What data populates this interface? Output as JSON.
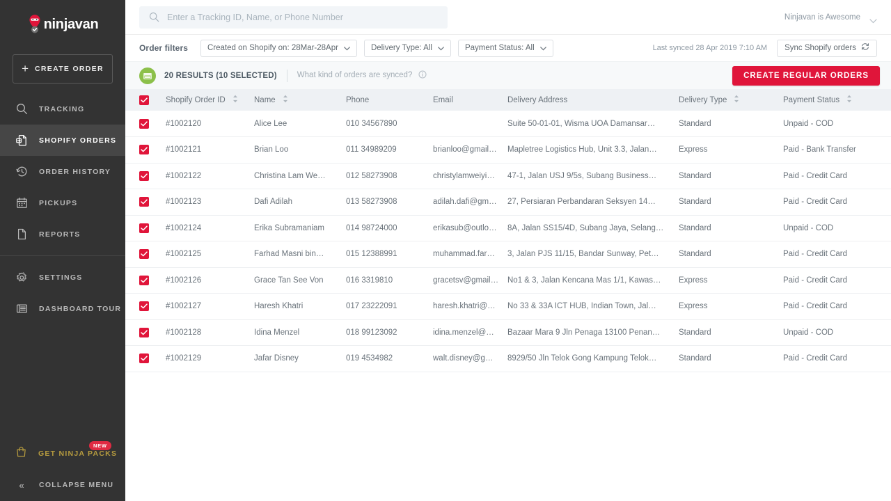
{
  "brand": {
    "name": "ninjavan",
    "accent_red": "#e0153a",
    "sidebar_bg": "#333333",
    "green": "#8cc04a",
    "gold": "#b79c3f"
  },
  "sidebar": {
    "create_order_label": "CREATE ORDER",
    "items": [
      {
        "label": "TRACKING",
        "icon": "search-icon",
        "active": false
      },
      {
        "label": "SHOPIFY ORDERS",
        "icon": "shopify-orders-icon",
        "active": true
      },
      {
        "label": "ORDER HISTORY",
        "icon": "history-clock-icon",
        "active": false
      },
      {
        "label": "PICKUPS",
        "icon": "calendar-icon",
        "active": false
      },
      {
        "label": "REPORTS",
        "icon": "document-icon",
        "active": false
      },
      {
        "label": "SETTINGS",
        "icon": "gear-icon",
        "active": false
      },
      {
        "label": "DASHBOARD TOUR",
        "icon": "list-panel-icon",
        "active": false
      }
    ],
    "ninja_packs": {
      "label": "GET NINJA PACKS",
      "badge": "NEW",
      "icon": "shopping-bag-icon"
    },
    "collapse": {
      "label": "COLLAPSE MENU",
      "icon": "double-chevron-left-icon"
    }
  },
  "topbar": {
    "search_placeholder": "Enter a Tracking ID, Name, or Phone Number",
    "search_value": "",
    "user_name": "Ninjavan is Awesome"
  },
  "filters": {
    "label": "Order filters",
    "chips": [
      {
        "text": "Created on Shopify on: 28Mar-28Apr"
      },
      {
        "text": "Delivery Type: All"
      },
      {
        "text": "Payment Status: All"
      }
    ],
    "last_synced": "Last synced 28 Apr 2019 7:10 AM",
    "sync_button": "Sync Shopify orders"
  },
  "results": {
    "count_text": "20 RESULTS (10 SELECTED)",
    "help_text": "What kind of orders are synced?",
    "cta_label": "CREATE REGULAR ORDERS"
  },
  "table": {
    "columns": [
      {
        "key": "checkbox",
        "label": "",
        "sortable": false
      },
      {
        "key": "shopify_order_id",
        "label": "Shopify Order ID",
        "sortable": true
      },
      {
        "key": "name",
        "label": "Name",
        "sortable": true
      },
      {
        "key": "phone",
        "label": "Phone",
        "sortable": false
      },
      {
        "key": "email",
        "label": "Email",
        "sortable": false
      },
      {
        "key": "delivery_address",
        "label": "Delivery Address",
        "sortable": false
      },
      {
        "key": "delivery_type",
        "label": "Delivery Type",
        "sortable": true
      },
      {
        "key": "payment_status",
        "label": "Payment Status",
        "sortable": true
      }
    ],
    "rows": [
      {
        "checked": true,
        "shopify_order_id": "#1002120",
        "name": "Alice Lee",
        "phone": "010 34567890",
        "email": "",
        "delivery_address": "Suite 50-01-01, Wisma UOA Damansar…",
        "delivery_type": "Standard",
        "payment_status": "Unpaid - COD"
      },
      {
        "checked": true,
        "shopify_order_id": "#1002121",
        "name": "Brian Loo",
        "phone": "011 34989209",
        "email": "brianloo@gmail…",
        "delivery_address": "Mapletree Logistics Hub, Unit 3.3, Jalan…",
        "delivery_type": "Express",
        "payment_status": "Paid - Bank Transfer"
      },
      {
        "checked": true,
        "shopify_order_id": "#1002122",
        "name": "Christina Lam We…",
        "phone": "012 58273908",
        "email": "christylamweiyi…",
        "delivery_address": "47-1, Jalan USJ 9/5s, Subang Business…",
        "delivery_type": "Standard",
        "payment_status": "Paid - Credit Card"
      },
      {
        "checked": true,
        "shopify_order_id": "#1002123",
        "name": "Dafi Adilah",
        "phone": "013 58273908",
        "email": "adilah.dafi@gm…",
        "delivery_address": "27, Persiaran Perbandaran Seksyen 14…",
        "delivery_type": "Standard",
        "payment_status": "Paid - Credit Card"
      },
      {
        "checked": true,
        "shopify_order_id": "#1002124",
        "name": "Erika Subramaniam",
        "phone": "014 98724000",
        "email": "erikasub@outlo…",
        "delivery_address": "8A, Jalan SS15/4D, Subang Jaya, Selang…",
        "delivery_type": "Standard",
        "payment_status": "Unpaid - COD"
      },
      {
        "checked": true,
        "shopify_order_id": "#1002125",
        "name": "Farhad Masni bin…",
        "phone": "015 12388991",
        "email": "muhammad.far…",
        "delivery_address": "3, Jalan PJS 11/15, Bandar Sunway, Pet…",
        "delivery_type": "Standard",
        "payment_status": "Paid - Credit Card"
      },
      {
        "checked": true,
        "shopify_order_id": "#1002126",
        "name": "Grace Tan See Von",
        "phone": "016 3319810",
        "email": "gracetsv@gmail…",
        "delivery_address": "No1 & 3, Jalan Kencana Mas 1/1, Kawas…",
        "delivery_type": "Express",
        "payment_status": "Paid - Credit Card"
      },
      {
        "checked": true,
        "shopify_order_id": "#1002127",
        "name": "Haresh Khatri",
        "phone": "017 23222091",
        "email": "haresh.khatri@…",
        "delivery_address": "No 33 & 33A ICT HUB, Indian Town, Jal…",
        "delivery_type": "Express",
        "payment_status": "Paid - Credit Card"
      },
      {
        "checked": true,
        "shopify_order_id": "#1002128",
        "name": "Idina Menzel",
        "phone": "018 99123092",
        "email": "idina.menzel@…",
        "delivery_address": "Bazaar Mara 9 Jln Penaga 13100 Penan…",
        "delivery_type": "Standard",
        "payment_status": "Unpaid - COD"
      },
      {
        "checked": true,
        "shopify_order_id": "#1002129",
        "name": "Jafar Disney",
        "phone": "019 4534982",
        "email": "walt.disney@g…",
        "delivery_address": "8929/50 Jln Telok Gong Kampung Telok…",
        "delivery_type": "Standard",
        "payment_status": "Paid - Credit Card"
      }
    ]
  }
}
